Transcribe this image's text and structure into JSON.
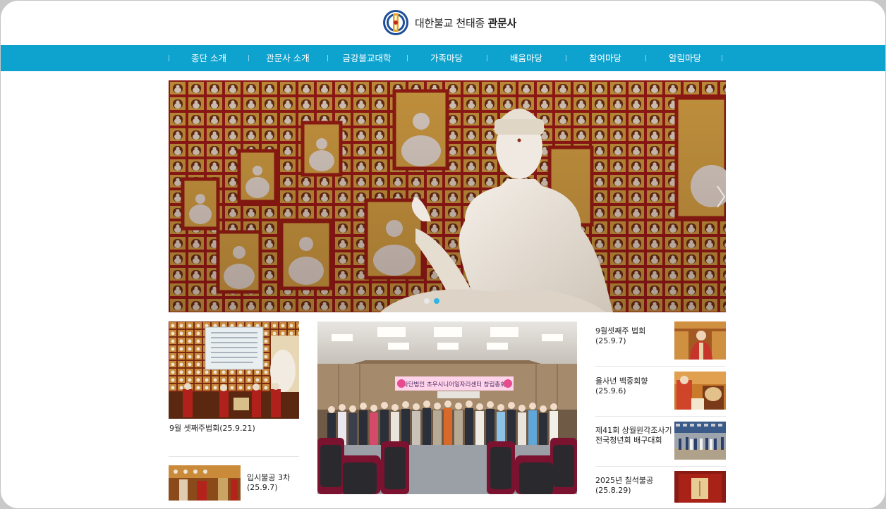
{
  "header": {
    "site_name_prefix": "대한불교 천태종",
    "site_name_main": "관문사"
  },
  "nav": {
    "items": [
      {
        "label": "종단 소개"
      },
      {
        "label": "관문사 소개"
      },
      {
        "label": "금강불교대학"
      },
      {
        "label": "가족마당"
      },
      {
        "label": "배움마당"
      },
      {
        "label": "참여마당"
      },
      {
        "label": "알림마당"
      }
    ]
  },
  "hero": {
    "slide_count": 2,
    "active_slide": 2
  },
  "left_news": [
    {
      "caption": "9월 셋째주법회(25.9.21)"
    },
    {
      "title": "입시불공 3차",
      "date": "(25.9.7)"
    }
  ],
  "center_photo": {
    "banner_text": "사단법인 초우시니어일자리센터 창립총회"
  },
  "side_news": [
    {
      "title": "9월셋째주 법회",
      "date": "(25.9.7)"
    },
    {
      "title": "을사년 백중회향",
      "date": "(25.9.6)"
    },
    {
      "title": "제41회 상월원각조사기",
      "title2": "전국청년회 배구대회",
      "date": ""
    },
    {
      "title": "2025년 칠석불공",
      "date": "(25.8.29)"
    }
  ],
  "colors": {
    "nav_bg": "#0ea3cf",
    "dot_active": "#2bb6e6",
    "dot_inactive": "#e8e8e8"
  }
}
